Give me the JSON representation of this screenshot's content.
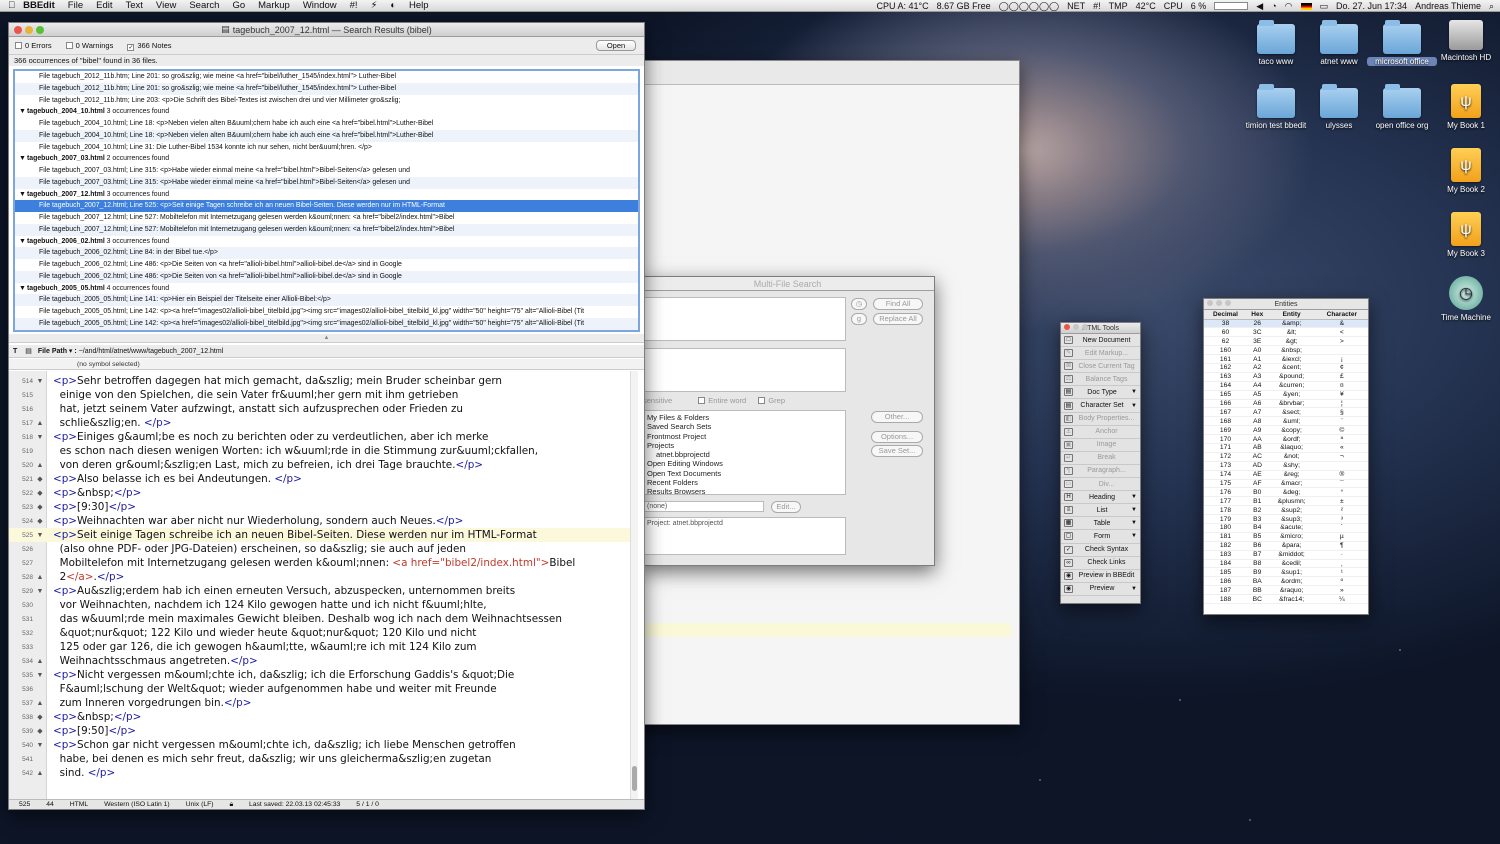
{
  "menubar": {
    "app": "BBEdit",
    "items": [
      "File",
      "Edit",
      "Text",
      "View",
      "Search",
      "Go",
      "Markup",
      "Window",
      "#!",
      "Help"
    ],
    "cpu_a": "CPU A: 41°C",
    "free": "8.67 GB Free",
    "net": "NET",
    "tmp": "TMP",
    "cpu_temp": "42°C",
    "cpu": "CPU",
    "cpu_pct": "6 %",
    "date": "Do. 27. Jun  17:34",
    "user": "Andreas Thieme"
  },
  "desktop": {
    "icons": [
      {
        "label": "taco www"
      },
      {
        "label": "atnet www"
      },
      {
        "label": "microsoft office"
      },
      {
        "label": "Macintosh HD"
      },
      {
        "label": "timion test bbedit"
      },
      {
        "label": "ulysses"
      },
      {
        "label": "open office org"
      },
      {
        "label": "My Book 1"
      },
      {
        "label": "My Book 2"
      },
      {
        "label": "My Book 3"
      },
      {
        "label": "Time Machine"
      }
    ]
  },
  "main_window": {
    "title": "tagebuch_2007_12.html — Search Results (bibel)",
    "errors": "0 Errors",
    "warnings": "0 Warnings",
    "notes": "366 Notes",
    "open_button": "Open",
    "summary": "366 occurrences of \"bibel\" found in 36 files.",
    "results": [
      {
        "type": "item",
        "text": "File tagebuch_2012_11b.htm; Line 201:   so gro&szlig; wie meine <a href=\"bibel/luther_1545/index.html\"> Luther-Bibel"
      },
      {
        "type": "item",
        "text": "File tagebuch_2012_11b.htm; Line 201:   so gro&szlig; wie meine <a href=\"bibel/luther_1545/index.html\"> Luther-Bibel"
      },
      {
        "type": "item",
        "text": "File tagebuch_2012_11b.htm; Line 203:   <p>Die Schrift des Bibel-Textes ist zwischen drei und vier Millimeter gro&szlig;"
      },
      {
        "type": "group",
        "name": "tagebuch_2004_10.html",
        "count": "3 occurrences found"
      },
      {
        "type": "item",
        "text": "File tagebuch_2004_10.html; Line 18:   <p>Neben vielen alten B&uuml;chern habe ich auch eine <a href=\"bibel.html\">Luther-Bibel"
      },
      {
        "type": "item",
        "text": "File tagebuch_2004_10.html; Line 18:   <p>Neben vielen alten B&uuml;chern habe ich auch eine <a href=\"bibel.html\">Luther-Bibel"
      },
      {
        "type": "item",
        "text": "File tagebuch_2004_10.html; Line 31:   Die Luther-Bibel 1534 konnte ich nur sehen, nicht ber&uuml;hren. </p>"
      },
      {
        "type": "group",
        "name": "tagebuch_2007_03.html",
        "count": "2 occurrences found"
      },
      {
        "type": "item",
        "text": "File tagebuch_2007_03.html; Line 315:   <p>Habe wieder einmal meine <a href=\"bibel.html\">Bibel-Seiten</a> gelesen und"
      },
      {
        "type": "item",
        "text": "File tagebuch_2007_03.html; Line 315:   <p>Habe wieder einmal meine <a href=\"bibel.html\">Bibel-Seiten</a> gelesen und"
      },
      {
        "type": "group",
        "name": "tagebuch_2007_12.html",
        "count": "3 occurrences found"
      },
      {
        "type": "sel",
        "text": "File tagebuch_2007_12.html; Line 525:   <p>Seit einige Tagen schreibe ich an neuen Bibel-Seiten. Diese werden nur im HTML-Format"
      },
      {
        "type": "item",
        "text": "File tagebuch_2007_12.html; Line 527:   Mobiltelefon mit Internetzugang gelesen werden k&ouml;nnen: <a href=\"bibel2/index.html\">Bibel"
      },
      {
        "type": "item",
        "text": "File tagebuch_2007_12.html; Line 527:   Mobiltelefon mit Internetzugang gelesen werden k&ouml;nnen: <a href=\"bibel2/index.html\">Bibel"
      },
      {
        "type": "group",
        "name": "tagebuch_2006_02.html",
        "count": "3 occurrences found"
      },
      {
        "type": "item",
        "text": "File tagebuch_2006_02.html; Line 84:   in der Bibel tue.</p>"
      },
      {
        "type": "item",
        "text": "File tagebuch_2006_02.html; Line 486:   <p>Die Seiten von <a href=\"allioli-bibel.html\">allioli-bibel.de</a> sind in Google"
      },
      {
        "type": "item",
        "text": "File tagebuch_2006_02.html; Line 486:   <p>Die Seiten von <a href=\"allioli-bibel.html\">allioli-bibel.de</a> sind in Google"
      },
      {
        "type": "group",
        "name": "tagebuch_2005_05.html",
        "count": "4 occurrences found"
      },
      {
        "type": "item",
        "text": "File tagebuch_2005_05.html; Line 141:   <p>Hier ein Beispiel der Titelseite einer Allioli-Bibel:</p>"
      },
      {
        "type": "item",
        "text": "File tagebuch_2005_05.html; Line 142:   <p><a href=\"images02/allioli-bibel_titelbild.jpg\"><img src=\"images02/allioli-bibel_titelbild_kl.jpg\" width=\"50\" height=\"75\"    alt=\"Allioli-Bibel (Tit"
      },
      {
        "type": "item",
        "text": "File tagebuch_2005_05.html; Line 142:   <p><a href=\"images02/allioli-bibel_titelbild.jpg\"><img src=\"images02/allioli-bibel_titelbild_kl.jpg\" width=\"50\" height=\"75\"    alt=\"Allioli-Bibel (Tit"
      }
    ],
    "path_label": "File Path ▾ :",
    "path": "~/and/html/atnet/www/tagebuch_2007_12.html",
    "symbol": "(no symbol selected)",
    "code_lines": [
      {
        "n": "514",
        "f": "▼",
        "html": "<span class='tag'>&lt;p&gt;</span>Sehr betroffen dagegen hat mich gemacht, da&amp;szlig; mein Bruder scheinbar gern"
      },
      {
        "n": "515",
        "f": "",
        "html": "  einige von den Spielchen, die sein Vater fr&amp;uuml;her gern mit ihm getrieben"
      },
      {
        "n": "516",
        "f": "",
        "html": "  hat, jetzt seinem Vater aufzwingt, anstatt sich aufzusprechen oder Frieden zu"
      },
      {
        "n": "517",
        "f": "▲",
        "html": "  schlie&amp;szlig;en. <span class='tag'>&lt;/p&gt;</span>"
      },
      {
        "n": "518",
        "f": "▼",
        "html": "<span class='tag'>&lt;p&gt;</span>Einiges g&amp;auml;be es noch zu berichten oder zu verdeutlichen, aber ich merke"
      },
      {
        "n": "519",
        "f": "",
        "html": "  es schon nach diesen wenigen Worten: ich w&amp;uuml;rde in die Stimmung zur&amp;uuml;ckfallen,"
      },
      {
        "n": "520",
        "f": "▲",
        "html": "  von deren gr&amp;ouml;&amp;szlig;en Last, mich zu befreien, ich drei Tage brauchte.<span class='tag'>&lt;/p&gt;</span>"
      },
      {
        "n": "521",
        "f": "◆",
        "html": "<span class='tag'>&lt;p&gt;</span>Also belasse ich es bei Andeutungen. <span class='tag'>&lt;/p&gt;</span>"
      },
      {
        "n": "522",
        "f": "◆",
        "html": "<span class='tag'>&lt;p&gt;</span>&amp;nbsp;<span class='tag'>&lt;/p&gt;</span>"
      },
      {
        "n": "523",
        "f": "◆",
        "html": "<span class='tag'>&lt;p&gt;</span>[9:30]<span class='tag'>&lt;/p&gt;</span>"
      },
      {
        "n": "524",
        "f": "◆",
        "html": "<span class='tag'>&lt;p&gt;</span>Weihnachten war aber nicht nur Wiederholung, sondern auch Neues.<span class='tag'>&lt;/p&gt;</span>"
      },
      {
        "n": "525",
        "f": "▼",
        "cur": true,
        "html": "<span class='tag'>&lt;p&gt;</span>Seit einige Tagen schreibe ich an neuen Bibel-Seiten. Diese werden nur im HTML-Format"
      },
      {
        "n": "526",
        "f": "",
        "html": "  (also ohne PDF- oder JPG-Dateien) erscheinen, so da&amp;szlig; sie auch auf jeden"
      },
      {
        "n": "527",
        "f": "",
        "html": "  Mobiltelefon mit Internetzugang gelesen werden k&amp;ouml;nnen: <span class='str'>&lt;a href=\"bibel2/index.html\"&gt;</span>Bibel"
      },
      {
        "n": "528",
        "f": "▲",
        "html": "  2<span class='str'>&lt;/a&gt;</span>.<span class='tag'>&lt;/p&gt;</span>"
      },
      {
        "n": "529",
        "f": "▼",
        "html": "<span class='tag'>&lt;p&gt;</span>Au&amp;szlig;erdem hab ich einen erneuten Versuch, abzuspecken, unternommen breits"
      },
      {
        "n": "530",
        "f": "",
        "html": "  vor Weihnachten, nachdem ich 124 Kilo gewogen hatte und ich nicht f&amp;uuml;hlte,"
      },
      {
        "n": "531",
        "f": "",
        "html": "  das w&amp;uuml;rde mein maximales Gewicht bleiben. Deshalb wog ich nach dem Weihnachtsessen"
      },
      {
        "n": "532",
        "f": "",
        "html": "  &amp;quot;nur&amp;quot; 122 Kilo und wieder heute &amp;quot;nur&amp;quot; 120 Kilo und nicht"
      },
      {
        "n": "533",
        "f": "",
        "html": "  125 oder gar 126, die ich gewogen h&amp;auml;tte, w&amp;auml;re ich mit 124 Kilo zum"
      },
      {
        "n": "534",
        "f": "▲",
        "html": "  Weihnachtsschmaus angetreten.<span class='tag'>&lt;/p&gt;</span>"
      },
      {
        "n": "535",
        "f": "▼",
        "html": "<span class='tag'>&lt;p&gt;</span>Nicht vergessen m&amp;ouml;chte ich, da&amp;szlig; ich die Erforschung Gaddis's &amp;quot;Die"
      },
      {
        "n": "536",
        "f": "",
        "html": "  F&amp;auml;lschung der Welt&amp;quot; wieder aufgenommen habe und weiter mit Freunde"
      },
      {
        "n": "537",
        "f": "▲",
        "html": "  zum Inneren vorgedrungen bin.<span class='tag'>&lt;/p&gt;</span>"
      },
      {
        "n": "538",
        "f": "◆",
        "html": "<span class='tag'>&lt;p&gt;</span>&amp;nbsp;<span class='tag'>&lt;/p&gt;</span>"
      },
      {
        "n": "539",
        "f": "◆",
        "html": "<span class='tag'>&lt;p&gt;</span>[9:50]<span class='tag'>&lt;/p&gt;</span>"
      },
      {
        "n": "540",
        "f": "▼",
        "html": "<span class='tag'>&lt;p&gt;</span>Schon gar nicht vergessen m&amp;ouml;chte ich, da&amp;szlig; ich liebe Menschen getroffen"
      },
      {
        "n": "541",
        "f": "",
        "html": "  habe, bei denen es mich sehr freut, da&amp;szlig; wir uns gleicherma&amp;szlig;en zugetan"
      },
      {
        "n": "542",
        "f": "▲",
        "html": "  sind. <span class='tag'>&lt;/p&gt;</span>"
      }
    ],
    "status": {
      "line": "525",
      "col": "44",
      "lang": "HTML",
      "encoding": "Western (ISO Latin 1)",
      "linebreaks": "Unix (LF)",
      "saved": "Last saved: 22.03.13 02:45:33",
      "counts": "5 / 1 / 0"
    }
  },
  "mfs": {
    "title": "Multi-File Search",
    "find_all": "Find All",
    "replace_all": "Replace All",
    "sensitive": "sensitive",
    "entire_word": "Entire word",
    "grep": "Grep",
    "sources": [
      "My Files & Folders",
      "Saved Search Sets",
      "Frontmost Project",
      "Projects",
      "atnet.bbprojectd",
      "Open Editing Windows",
      "Open Text Documents",
      "Recent Folders",
      "Results Browsers"
    ],
    "other": "Other...",
    "options": "Options...",
    "save_set": "Save Set...",
    "filter": "(none)",
    "edit": "Edit...",
    "project": "Project: atnet.bbprojectd"
  },
  "html_tools": {
    "title": "HTML Tools",
    "items": [
      {
        "label": "New Document",
        "icon": "□",
        "dis": false,
        "arrow": false
      },
      {
        "label": "Edit Markup...",
        "icon": "✎",
        "dis": true,
        "arrow": false
      },
      {
        "label": "Close Current Tag",
        "icon": "⊠",
        "dis": true,
        "arrow": false
      },
      {
        "label": "Balance Tags",
        "icon": "⚖",
        "dis": true,
        "arrow": false
      },
      {
        "label": "Doc Type",
        "icon": "▤",
        "dis": false,
        "arrow": true
      },
      {
        "label": "Character Set",
        "icon": "▤",
        "dis": false,
        "arrow": true
      },
      {
        "label": "Body Properties...",
        "icon": "◧",
        "dis": true,
        "arrow": false
      },
      {
        "label": "Anchor",
        "icon": "⚓",
        "dis": true,
        "arrow": false
      },
      {
        "label": "Image",
        "icon": "▣",
        "dis": true,
        "arrow": false
      },
      {
        "label": "Break",
        "icon": "↵",
        "dis": true,
        "arrow": false
      },
      {
        "label": "Paragraph...",
        "icon": "¶",
        "dis": true,
        "arrow": false
      },
      {
        "label": "Div...",
        "icon": "▭",
        "dis": true,
        "arrow": false
      },
      {
        "label": "Heading",
        "icon": "H",
        "dis": false,
        "arrow": true
      },
      {
        "label": "List",
        "icon": "≡",
        "dis": false,
        "arrow": true
      },
      {
        "label": "Table",
        "icon": "▦",
        "dis": false,
        "arrow": true
      },
      {
        "label": "Form",
        "icon": "▢",
        "dis": false,
        "arrow": true
      },
      {
        "label": "Check Syntax",
        "icon": "✓",
        "dis": false,
        "arrow": false
      },
      {
        "label": "Check Links",
        "icon": "∞",
        "dis": false,
        "arrow": false
      },
      {
        "label": "Preview in BBEdit",
        "icon": "◉",
        "dis": false,
        "arrow": false
      },
      {
        "label": "Preview",
        "icon": "◉",
        "dis": false,
        "arrow": true
      }
    ]
  },
  "entities": {
    "title": "Entities",
    "headers": [
      "Decimal",
      "Hex",
      "Entity",
      "Character"
    ],
    "rows": [
      [
        "38",
        "26",
        "&amp;",
        "&"
      ],
      [
        "60",
        "3C",
        "&lt;",
        "<"
      ],
      [
        "62",
        "3E",
        "&gt;",
        ">"
      ],
      [
        "160",
        "A0",
        "&nbsp;",
        ""
      ],
      [
        "161",
        "A1",
        "&iexcl;",
        "¡"
      ],
      [
        "162",
        "A2",
        "&cent;",
        "¢"
      ],
      [
        "163",
        "A3",
        "&pound;",
        "£"
      ],
      [
        "164",
        "A4",
        "&curren;",
        "¤"
      ],
      [
        "165",
        "A5",
        "&yen;",
        "¥"
      ],
      [
        "166",
        "A6",
        "&brvbar;",
        "¦"
      ],
      [
        "167",
        "A7",
        "&sect;",
        "§"
      ],
      [
        "168",
        "A8",
        "&uml;",
        "¨"
      ],
      [
        "169",
        "A9",
        "&copy;",
        "©"
      ],
      [
        "170",
        "AA",
        "&ordf;",
        "ª"
      ],
      [
        "171",
        "AB",
        "&laquo;",
        "«"
      ],
      [
        "172",
        "AC",
        "&not;",
        "¬"
      ],
      [
        "173",
        "AD",
        "&shy;",
        ""
      ],
      [
        "174",
        "AE",
        "&reg;",
        "®"
      ],
      [
        "175",
        "AF",
        "&macr;",
        "¯"
      ],
      [
        "176",
        "B0",
        "&deg;",
        "°"
      ],
      [
        "177",
        "B1",
        "&plusmn;",
        "±"
      ],
      [
        "178",
        "B2",
        "&sup2;",
        "²"
      ],
      [
        "179",
        "B3",
        "&sup3;",
        "³"
      ],
      [
        "180",
        "B4",
        "&acute;",
        "´"
      ],
      [
        "181",
        "B5",
        "&micro;",
        "µ"
      ],
      [
        "182",
        "B6",
        "&para;",
        "¶"
      ],
      [
        "183",
        "B7",
        "&middot;",
        "·"
      ],
      [
        "184",
        "B8",
        "&cedil;",
        "¸"
      ],
      [
        "185",
        "B9",
        "&sup1;",
        "¹"
      ],
      [
        "186",
        "BA",
        "&ordm;",
        "º"
      ],
      [
        "187",
        "BB",
        "&raquo;",
        "»"
      ],
      [
        "188",
        "BC",
        "&frac14;",
        "¼"
      ]
    ]
  }
}
